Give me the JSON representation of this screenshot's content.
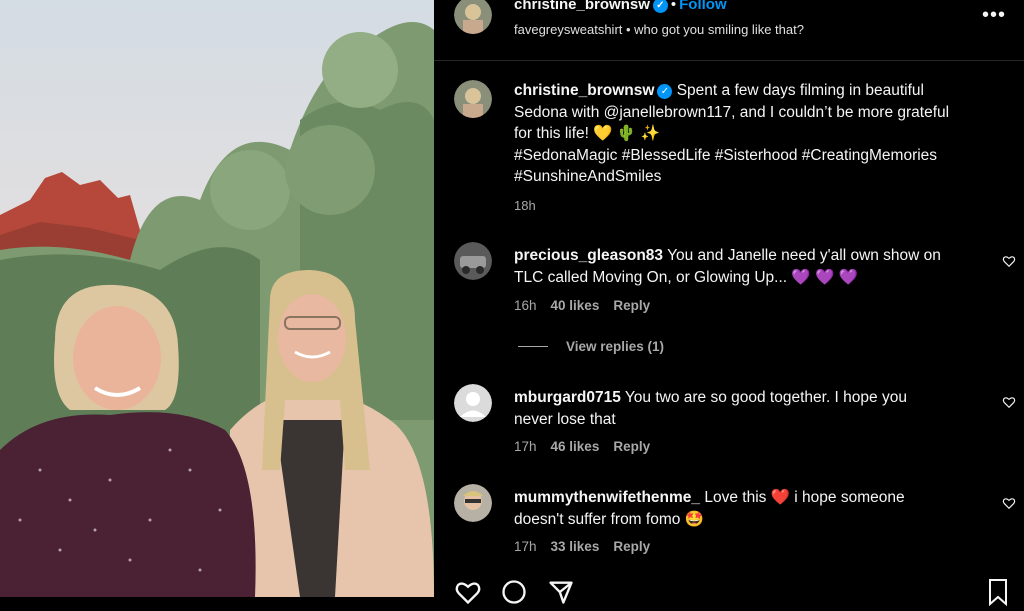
{
  "post": {
    "username": "christine_brownsw",
    "dot": "•",
    "follow_label": "Follow",
    "audio_line": "favegreysweatshirt • who got you smiling like that?",
    "more_label": "•••"
  },
  "caption": {
    "username": "christine_brownsw",
    "text_line1": "Spent a few days filming in beautiful",
    "text_line2": "Sedona with @janellebrown117, and I couldn’t be more grateful",
    "text_line3": "for this life! 💛 🌵 ✨",
    "hashtags_line1": "#SedonaMagic #BlessedLife #Sisterhood #CreatingMemories",
    "hashtags_line2": "#SunshineAndSmiles",
    "time": "18h"
  },
  "comments": [
    {
      "username": "precious_gleason83",
      "text_line1": "You and Janelle need y'all own show on",
      "text_line2": "TLC called Moving On, or Glowing Up... 💜 💜 💜",
      "time": "16h",
      "likes": "40 likes",
      "reply": "Reply"
    },
    {
      "username": "mburgard0715",
      "text_line1": "You two are so good together. I hope you",
      "text_line2": "never lose that",
      "time": "17h",
      "likes": "46 likes",
      "reply": "Reply"
    },
    {
      "username": "mummythenwifethenme_",
      "text_line1": "Love this ❤️  i hope someone",
      "text_line2": "doesn't suffer from fomo 🤩",
      "time": "17h",
      "likes": "33 likes",
      "reply": "Reply"
    }
  ],
  "view_replies_label": "View replies (1)",
  "colors": {
    "accent": "#0095f6",
    "background": "#000000",
    "muted": "#a8a8a8"
  },
  "icons": [
    "verified-icon",
    "more-options-icon",
    "heart-icon",
    "comment-icon",
    "share-icon",
    "bookmark-icon"
  ]
}
